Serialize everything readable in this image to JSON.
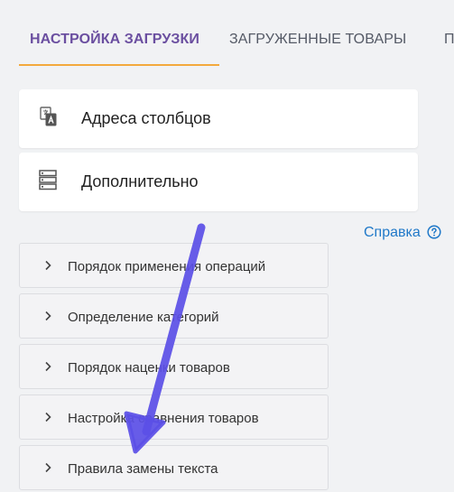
{
  "tabs": [
    {
      "label": "НАСТРОЙКА ЗАГРУЗКИ",
      "active": true
    },
    {
      "label": "ЗАГРУЖЕННЫЕ ТОВАРЫ",
      "active": false
    },
    {
      "label": "П",
      "active": false
    }
  ],
  "colors": {
    "active_tab": "#6b4fa0",
    "tab_underline": "#f3a93c",
    "link": "#1f78c8",
    "annotation_arrow": "#5b4fe6"
  },
  "cards": [
    {
      "label": "Адреса столбцов",
      "icon": "translate-icon"
    },
    {
      "label": "Дополнительно",
      "icon": "server-icon"
    }
  ],
  "help": {
    "label": "Справка",
    "icon": "question-circle-icon"
  },
  "accordion": [
    {
      "label": "Порядок применения операций"
    },
    {
      "label": "Определение категорий"
    },
    {
      "label": "Порядок наценки товаров"
    },
    {
      "label": "Настройка сравнения товаров"
    },
    {
      "label": "Правила замены текста"
    }
  ]
}
